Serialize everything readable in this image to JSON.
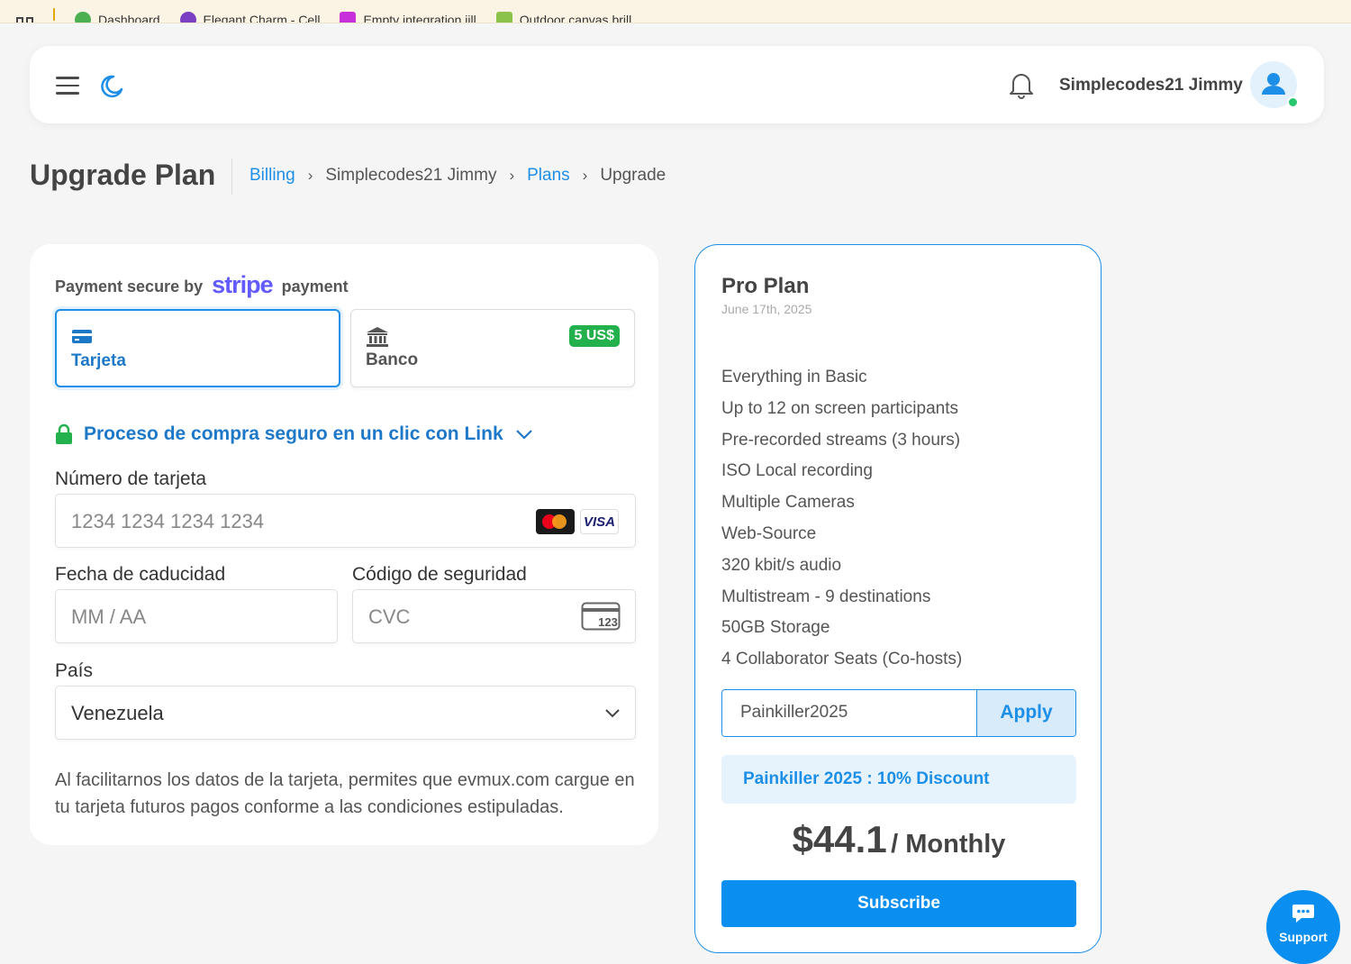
{
  "bookmarks": [
    {
      "label": "Dashboard",
      "color": "#4caf50"
    },
    {
      "label": "Elegant Charm - Cell",
      "color": "#7b3fc4"
    },
    {
      "label": "Empty integration jill",
      "color": "#c62fd9"
    },
    {
      "label": "Outdoor canvas brill",
      "color": "#8bc34a"
    }
  ],
  "header": {
    "username": "Simplecodes21 Jimmy",
    "icons": [
      "menu-icon",
      "moon-icon",
      "bell-icon",
      "user-icon"
    ]
  },
  "page": {
    "title": "Upgrade Plan",
    "breadcrumb": [
      "Billing",
      "Simplecodes21 Jimmy",
      "Plans",
      "Upgrade"
    ]
  },
  "payment": {
    "secure_prefix": "Payment secure by",
    "brand": "stripe",
    "secure_suffix": "payment",
    "methods": [
      {
        "label": "Tarjeta",
        "icon": "card-icon",
        "selected": true
      },
      {
        "label": "Banco",
        "icon": "bank-icon",
        "badge": "5 US$"
      }
    ],
    "link_text": "Proceso de compra seguro en un clic con Link",
    "card_number": {
      "label": "Número de tarjeta",
      "placeholder": "1234 1234 1234 1234"
    },
    "expiry": {
      "label": "Fecha de caducidad",
      "placeholder": "MM / AA"
    },
    "cvc": {
      "label": "Código de seguridad",
      "placeholder": "CVC",
      "icon_text": "123"
    },
    "country": {
      "label": "País",
      "value": "Venezuela"
    },
    "visa_text": "VISA",
    "disclaimer": "Al facilitarnos los datos de la tarjeta, permites que evmux.com cargue en tu tarjeta futuros pagos conforme a las condiciones estipuladas."
  },
  "plan": {
    "name": "Pro Plan",
    "date": "June 17th, 2025",
    "features": [
      "Everything in Basic",
      "Up to 12 on screen participants",
      "Pre-recorded streams (3 hours)",
      "ISO Local recording",
      "Multiple Cameras",
      "Web-Source",
      "320 kbit/s audio",
      "Multistream - 9 destinations",
      "50GB Storage",
      "4 Collaborator Seats (Co-hosts)"
    ],
    "coupon_value": "Painkiller2025",
    "apply_label": "Apply",
    "discount_text": "Painkiller 2025 : 10% Discount",
    "price": "$44.1",
    "period": "/ Monthly",
    "subscribe_label": "Subscribe"
  },
  "support_label": "Support",
  "colors": {
    "accent": "#1e8fe8",
    "primary_button": "#0a8ef0",
    "success": "#22b14c",
    "stripe": "#635bff"
  }
}
